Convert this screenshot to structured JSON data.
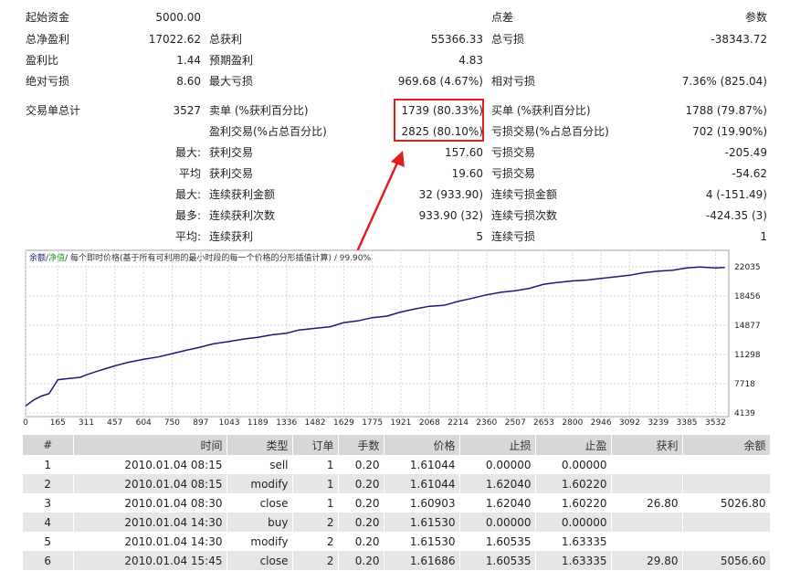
{
  "summary": {
    "initial_deposit_label": "起始资金",
    "initial_deposit": "5000.00",
    "spread_label": "点差",
    "params_label": "参数",
    "net_profit_label": "总净盈利",
    "net_profit": "17022.62",
    "gross_profit_label": "总获利",
    "gross_profit": "55366.33",
    "gross_loss_label": "总亏损",
    "gross_loss": "-38343.72",
    "profit_factor_label": "盈利比",
    "profit_factor": "1.44",
    "expected_payoff_label": "预期盈利",
    "expected_payoff": "4.83",
    "abs_drawdown_label": "绝对亏损",
    "abs_drawdown": "8.60",
    "max_drawdown_label": "最大亏损",
    "max_drawdown": "969.68 (4.67%)",
    "rel_drawdown_label": "相对亏损",
    "rel_drawdown": "7.36% (825.04)",
    "total_trades_label": "交易单总计",
    "total_trades": "3527",
    "short_label": "卖单 (%获利百分比)",
    "short_value": "1739 (80.33%)",
    "long_label": "买单 (%获利百分比)",
    "long_value": "1788 (79.87%)",
    "profit_trades_label": "盈利交易(%占总百分比)",
    "profit_trades_value": "2825 (80.10%)",
    "loss_trades_label": "亏损交易(%占总百分比)",
    "loss_trades_value": "702 (19.90%)",
    "largest_prefix": "最大:",
    "largest_profit_label": "获利交易",
    "largest_profit": "157.60",
    "largest_loss_label": "亏损交易",
    "largest_loss": "-205.49",
    "average_prefix": "平均",
    "average_profit_label": "获利交易",
    "average_profit": "19.60",
    "average_loss_label": "亏损交易",
    "average_loss": "-54.62",
    "max_consec_prefix": "最大:",
    "max_consec_wins_label": "连续获利金额",
    "max_consec_wins": "32 (933.90)",
    "max_consec_losses_label": "连续亏损金额",
    "max_consec_losses": "4 (-151.49)",
    "most_prefix": "最多:",
    "max_consec_profit_label": "连续获利次数",
    "max_consec_profit": "933.90 (32)",
    "max_consec_loss_label": "连续亏损次数",
    "max_consec_loss": "-424.35 (3)",
    "avg_consec_prefix": "平均:",
    "avg_consec_wins_label": "连续获利",
    "avg_consec_wins": "5",
    "avg_consec_losses_label": "连续亏损",
    "avg_consec_losses": "1"
  },
  "chart_data": {
    "type": "line",
    "legend_balance": "余额",
    "legend_separator": "/",
    "legend_equity": "净值",
    "legend_rest": "/ 每个即时价格(基于所有可利用的最小时段的每一个价格的分形插值计算) / 99.90%",
    "x_ticks": [
      "0",
      "165",
      "311",
      "457",
      "604",
      "750",
      "897",
      "1043",
      "1189",
      "1336",
      "1482",
      "1629",
      "1775",
      "1921",
      "2068",
      "2214",
      "2360",
      "2507",
      "2653",
      "2800",
      "2946",
      "3092",
      "3239",
      "3385",
      "3532"
    ],
    "y_ticks": [
      "22035",
      "18456",
      "14877",
      "11298",
      "7718",
      "4139"
    ],
    "xlim": [
      0,
      3600
    ],
    "ylim": [
      4139,
      22035
    ],
    "series": [
      {
        "color": "#1a1a7a",
        "x": [
          0,
          40,
          80,
          120,
          165,
          200,
          240,
          280,
          311,
          360,
          400,
          457,
          520,
          604,
          680,
          750,
          820,
          897,
          960,
          1043,
          1120,
          1189,
          1260,
          1336,
          1400,
          1482,
          1560,
          1629,
          1700,
          1775,
          1850,
          1921,
          2000,
          2068,
          2140,
          2214,
          2290,
          2360,
          2430,
          2507,
          2580,
          2653,
          2720,
          2800,
          2870,
          2946,
          3020,
          3092,
          3160,
          3239,
          3310,
          3385,
          3450,
          3532,
          3580
        ],
        "y": [
          5000,
          5700,
          6200,
          6500,
          8200,
          8300,
          8400,
          8500,
          8800,
          9200,
          9500,
          9900,
          10300,
          10700,
          11000,
          11400,
          11800,
          12200,
          12600,
          12900,
          13200,
          13400,
          13700,
          13900,
          14300,
          14500,
          14700,
          15200,
          15400,
          15800,
          16000,
          16500,
          16900,
          17200,
          17300,
          17800,
          18200,
          18600,
          18900,
          19100,
          19400,
          19900,
          20100,
          20300,
          20400,
          20600,
          20800,
          21000,
          21300,
          21500,
          21600,
          21900,
          22000,
          21900,
          21950
        ]
      }
    ]
  },
  "table": {
    "headers": [
      "#",
      "时间",
      "类型",
      "订单",
      "手数",
      "价格",
      "止损",
      "止盈",
      "获利",
      "余额"
    ],
    "rows": [
      [
        "1",
        "2010.01.04 08:15",
        "sell",
        "1",
        "0.20",
        "1.61044",
        "0.00000",
        "0.00000",
        "",
        ""
      ],
      [
        "2",
        "2010.01.04 08:15",
        "modify",
        "1",
        "0.20",
        "1.61044",
        "1.62040",
        "1.60220",
        "",
        ""
      ],
      [
        "3",
        "2010.01.04 08:30",
        "close",
        "1",
        "0.20",
        "1.60903",
        "1.62040",
        "1.60220",
        "26.80",
        "5026.80"
      ],
      [
        "4",
        "2010.01.04 14:30",
        "buy",
        "2",
        "0.20",
        "1.61530",
        "0.00000",
        "0.00000",
        "",
        ""
      ],
      [
        "5",
        "2010.01.04 14:30",
        "modify",
        "2",
        "0.20",
        "1.61530",
        "1.60535",
        "1.63335",
        "",
        ""
      ],
      [
        "6",
        "2010.01.04 15:45",
        "close",
        "2",
        "0.20",
        "1.61686",
        "1.60535",
        "1.63335",
        "29.80",
        "5056.60"
      ]
    ]
  },
  "colors": {
    "highlight_red": "#e02020",
    "balance_line": "#1a1a7a",
    "header_bg": "#d8d8d8",
    "row_alt_bg": "#e6e6e6"
  }
}
